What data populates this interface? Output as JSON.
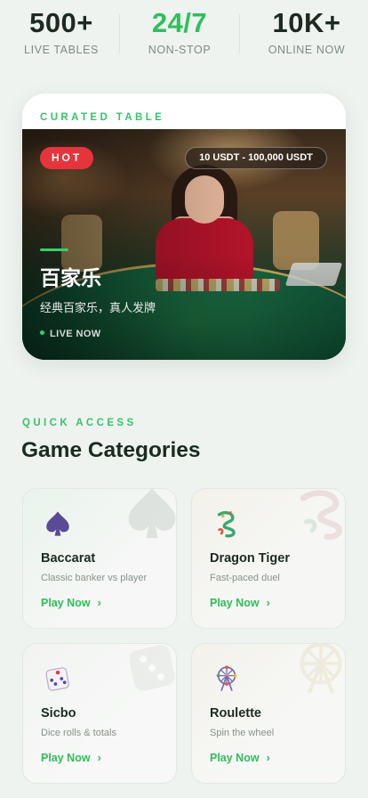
{
  "stats": [
    {
      "value": "500+",
      "label": "LIVE TABLES"
    },
    {
      "value": "24/7",
      "label": "NON-STOP"
    },
    {
      "value": "10K+",
      "label": "ONLINE NOW"
    }
  ],
  "featured": {
    "eyebrow": "CURATED TABLE",
    "badge": "HOT",
    "bet_range": "10 USDT - 100,000 USDT",
    "title": "百家乐",
    "subtitle": "经典百家乐，真人发牌",
    "status": "LIVE NOW"
  },
  "quick_access": {
    "eyebrow": "QUICK ACCESS",
    "title": "Game Categories",
    "categories": [
      {
        "name": "Baccarat",
        "desc": "Classic banker vs player",
        "cta": "Play Now",
        "icon": "spade-icon"
      },
      {
        "name": "Dragon Tiger",
        "desc": "Fast-paced duel",
        "cta": "Play Now",
        "icon": "dragon-icon"
      },
      {
        "name": "Sicbo",
        "desc": "Dice rolls & totals",
        "cta": "Play Now",
        "icon": "dice-icon"
      },
      {
        "name": "Roulette",
        "desc": "Spin the wheel",
        "cta": "Play Now",
        "icon": "ferris-wheel-icon"
      }
    ]
  },
  "colors": {
    "accent": "#2fbd5b",
    "hot": "#e6343d",
    "text": "#1b2b20",
    "background": "#eef3ef"
  }
}
